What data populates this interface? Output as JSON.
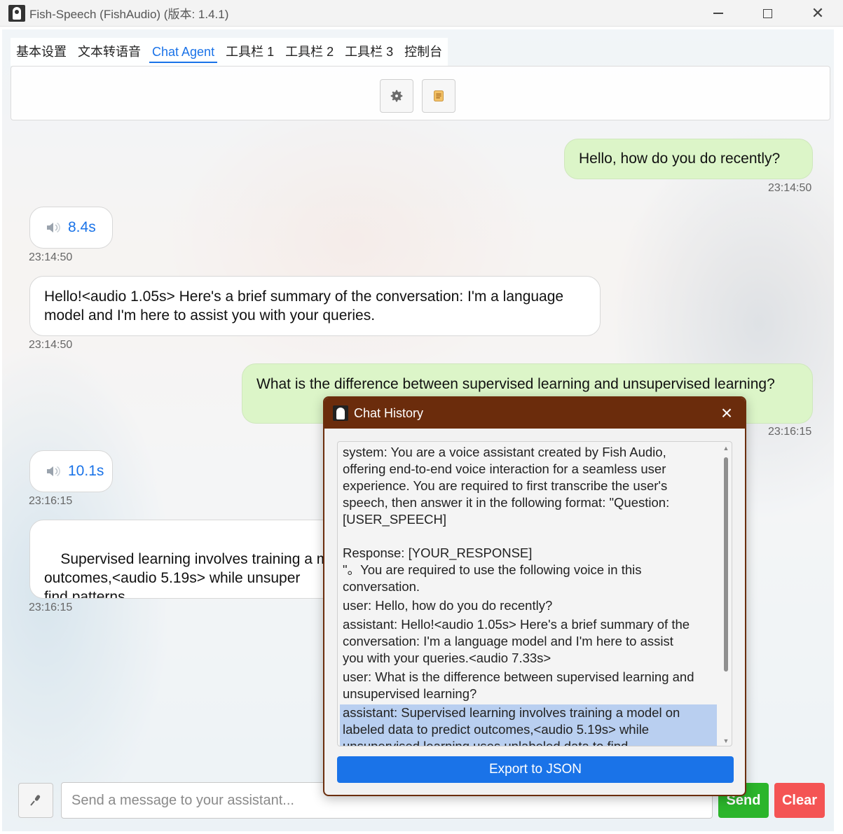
{
  "window": {
    "title": "Fish-Speech (FishAudio) (版本: 1.4.1)"
  },
  "tabs": [
    {
      "label": "基本设置"
    },
    {
      "label": "文本转语音"
    },
    {
      "label": "Chat Agent"
    },
    {
      "label": "工具栏 1"
    },
    {
      "label": "工具栏 2"
    },
    {
      "label": "工具栏 3"
    },
    {
      "label": "控制台"
    }
  ],
  "active_tab": "Chat Agent",
  "toolbar": {
    "buttons": [
      "gear-icon",
      "scroll-icon"
    ]
  },
  "chat": {
    "messages": [
      {
        "role": "user",
        "text": "Hello, how do you do recently?",
        "time": "23:14:50"
      },
      {
        "role": "assistant-audio",
        "duration": "8.4s",
        "time": "23:14:50"
      },
      {
        "role": "assistant",
        "text": "Hello!<audio 1.05s> Here's a brief summary of the conversation: I'm a language model and I'm here to assist you with your queries.",
        "time": "23:14:50"
      },
      {
        "role": "user",
        "text": "What is the difference between supervised learning and unsupervised learning?",
        "time": "23:16:15"
      },
      {
        "role": "assistant-audio",
        "duration": "10.1s",
        "time": "23:16:15"
      },
      {
        "role": "assistant",
        "text": "Supervised learning involves training a m\noutcomes,<audio 5.19s> while unsuper\nfind patterns.",
        "time": "23:16:15"
      }
    ]
  },
  "input": {
    "placeholder": "Send a message to your assistant...",
    "send_label": "Send",
    "clear_label": "Clear"
  },
  "dialog": {
    "title": "Chat History",
    "items": [
      "system: You are a voice assistant created by Fish Audio,\noffering end-to-end voice interaction for a seamless user\nexperience. You are required to first transcribe the user's\nspeech, then answer it in the following format: \"Question:\n[USER_SPEECH]\n\nResponse: [YOUR_RESPONSE]\n\"。You are required to use the following voice in this\nconversation.",
      "user: Hello, how do you do recently?",
      "assistant: Hello!<audio 1.05s> Here's a brief summary of the\nconversation: I'm a language model and I'm here to assist\nyou with your queries.<audio 7.33s>",
      "user: What is the difference between supervised learning and\nunsupervised learning?",
      "assistant: Supervised learning involves training a model on\nlabeled data to predict outcomes,<audio 5.19s> while\nunsupervised learning uses unlabeled data to find"
    ],
    "selected_index": 4,
    "export_label": "Export to JSON"
  },
  "colors": {
    "accent": "#1a73e8",
    "user_bubble": "#dcf5c8",
    "dialog_title": "#6b2c0c",
    "send": "#2bb52b",
    "clear": "#f45454"
  }
}
